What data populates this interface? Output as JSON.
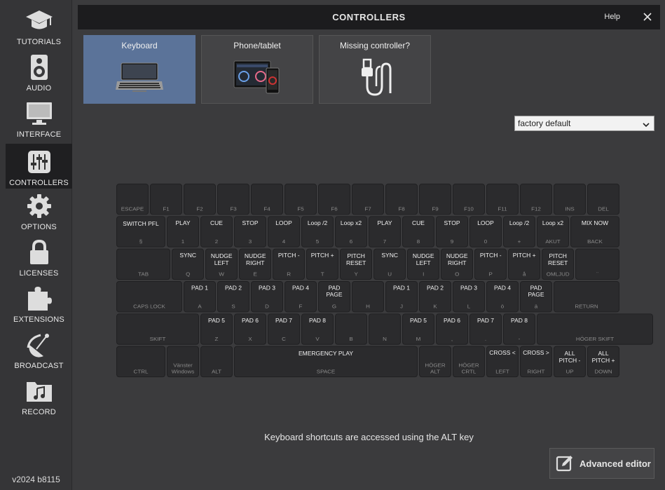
{
  "sidebar": {
    "items": [
      {
        "id": "tutorials",
        "label": "TUTORIALS",
        "icon": "graduation-cap-icon",
        "active": false
      },
      {
        "id": "audio",
        "label": "AUDIO",
        "icon": "speaker-icon",
        "active": false
      },
      {
        "id": "interface",
        "label": "INTERFACE",
        "icon": "monitor-icon",
        "active": false
      },
      {
        "id": "controllers",
        "label": "CONTROLLERS",
        "icon": "sliders-icon",
        "active": true
      },
      {
        "id": "options",
        "label": "OPTIONS",
        "icon": "gear-icon",
        "active": false
      },
      {
        "id": "licenses",
        "label": "LICENSES",
        "icon": "lock-icon",
        "active": false
      },
      {
        "id": "extensions",
        "label": "EXTENSIONS",
        "icon": "puzzle-icon",
        "active": false
      },
      {
        "id": "broadcast",
        "label": "BROADCAST",
        "icon": "satellite-dish-icon",
        "active": false
      },
      {
        "id": "record",
        "label": "RECORD",
        "icon": "music-folder-icon",
        "active": false
      }
    ],
    "version": "v2024 b8115"
  },
  "header": {
    "title": "CONTROLLERS",
    "help_label": "Help",
    "close_icon": "close-icon"
  },
  "tabs": [
    {
      "label": "Keyboard",
      "icon": "laptop-icon",
      "active": true
    },
    {
      "label": "Phone/tablet",
      "icon": "tablet-phone-icon",
      "active": false
    },
    {
      "label": "Missing controller?",
      "icon": "usb-cable-icon",
      "active": false
    }
  ],
  "preset": {
    "value": "factory default"
  },
  "keyboard": {
    "rows": [
      [
        {
          "act": "",
          "sym": "ESCAPE"
        },
        {
          "act": "",
          "sym": "F1"
        },
        {
          "act": "",
          "sym": "F2"
        },
        {
          "act": "",
          "sym": "F3"
        },
        {
          "act": "",
          "sym": "F4"
        },
        {
          "act": "",
          "sym": "F5"
        },
        {
          "act": "",
          "sym": "F6"
        },
        {
          "act": "",
          "sym": "F7"
        },
        {
          "act": "",
          "sym": "F8"
        },
        {
          "act": "",
          "sym": "F9"
        },
        {
          "act": "",
          "sym": "F10"
        },
        {
          "act": "",
          "sym": "F11"
        },
        {
          "act": "",
          "sym": "F12"
        },
        {
          "act": "",
          "sym": "INS"
        },
        {
          "act": "",
          "sym": "DEL"
        }
      ],
      [
        {
          "act": "SWITCH PFL",
          "sym": "§"
        },
        {
          "act": "PLAY",
          "sym": "1"
        },
        {
          "act": "CUE",
          "sym": "2"
        },
        {
          "act": "STOP",
          "sym": "3"
        },
        {
          "act": "LOOP",
          "sym": "4"
        },
        {
          "act": "Loop /2",
          "sym": "5"
        },
        {
          "act": "Loop x2",
          "sym": "6"
        },
        {
          "act": "PLAY",
          "sym": "7"
        },
        {
          "act": "CUE",
          "sym": "8"
        },
        {
          "act": "STOP",
          "sym": "9"
        },
        {
          "act": "LOOP",
          "sym": "0"
        },
        {
          "act": "Loop /2",
          "sym": "+"
        },
        {
          "act": "Loop x2",
          "sym": "AKUT"
        },
        {
          "act": "MIX NOW",
          "sym": "BACK"
        }
      ],
      [
        {
          "act": "",
          "sym": "TAB"
        },
        {
          "act": "SYNC",
          "sym": "Q"
        },
        {
          "act": "NUDGE LEFT",
          "sym": "W"
        },
        {
          "act": "NUDGE RIGHT",
          "sym": "E"
        },
        {
          "act": "PITCH -",
          "sym": "R"
        },
        {
          "act": "PITCH +",
          "sym": "T"
        },
        {
          "act": "PITCH RESET",
          "sym": "Y"
        },
        {
          "act": "SYNC",
          "sym": "U"
        },
        {
          "act": "NUDGE LEFT",
          "sym": "I"
        },
        {
          "act": "NUDGE RIGHT",
          "sym": "O"
        },
        {
          "act": "PITCH -",
          "sym": "P"
        },
        {
          "act": "PITCH +",
          "sym": "å"
        },
        {
          "act": "PITCH RESET",
          "sym": "OMLJUD"
        },
        {
          "act": "",
          "sym": "¨"
        }
      ],
      [
        {
          "act": "",
          "sym": "CAPS LOCK"
        },
        {
          "act": "PAD 1",
          "sym": "A"
        },
        {
          "act": "PAD 2",
          "sym": "S"
        },
        {
          "act": "PAD 3",
          "sym": "D"
        },
        {
          "act": "PAD 4",
          "sym": "F"
        },
        {
          "act": "PAD PAGE",
          "sym": "G"
        },
        {
          "act": "",
          "sym": "H"
        },
        {
          "act": "PAD 1",
          "sym": "J"
        },
        {
          "act": "PAD 2",
          "sym": "K"
        },
        {
          "act": "PAD 3",
          "sym": "L"
        },
        {
          "act": "PAD 4",
          "sym": "ö"
        },
        {
          "act": "PAD PAGE",
          "sym": "ä"
        },
        {
          "act": "",
          "sym": "RETURN"
        }
      ],
      [
        {
          "act": "",
          "sym": "SKIFT"
        },
        {
          "act": "PAD 5",
          "sym": "Z"
        },
        {
          "act": "PAD 6",
          "sym": "X"
        },
        {
          "act": "PAD 7",
          "sym": "C"
        },
        {
          "act": "PAD 8",
          "sym": "V"
        },
        {
          "act": "",
          "sym": "B"
        },
        {
          "act": "",
          "sym": "N"
        },
        {
          "act": "PAD 5",
          "sym": "M"
        },
        {
          "act": "PAD 6",
          "sym": ","
        },
        {
          "act": "PAD 7",
          "sym": "."
        },
        {
          "act": "PAD 8",
          "sym": "-"
        },
        {
          "act": "",
          "sym": "HÖGER SKIFT"
        }
      ],
      [
        {
          "act": "",
          "sym": "CTRL"
        },
        {
          "act": "",
          "sym": "Vänster Windows"
        },
        {
          "act": "",
          "sym": "ALT"
        },
        {
          "act": "EMERGENCY PLAY",
          "sym": "SPACE"
        },
        {
          "act": "",
          "sym": "HÖGER ALT"
        },
        {
          "act": "",
          "sym": "HÖGER CRTL"
        },
        {
          "act": "CROSS <",
          "sym": "LEFT"
        },
        {
          "act": "CROSS >",
          "sym": "RIGHT"
        },
        {
          "act": "ALL PITCH -",
          "sym": "UP"
        },
        {
          "act": "ALL PITCH +",
          "sym": "DOWN"
        }
      ]
    ]
  },
  "hint": "Keyboard shortcuts are accessed using the ALT key",
  "advanced_editor": {
    "label": "Advanced editor",
    "icon": "edit-icon"
  },
  "colors": {
    "accent": "#5b7399",
    "deck_left": "#2a4a8a",
    "deck_right": "#8a2a4a"
  }
}
